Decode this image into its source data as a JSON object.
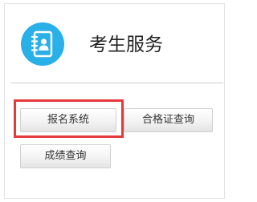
{
  "header": {
    "icon": "contact-book-icon",
    "title": "考生服务"
  },
  "buttons": {
    "registration_label": "报名系统",
    "certificate_query_label": "合格证查询",
    "score_query_label": "成绩查询"
  },
  "colors": {
    "accent": "#2ab0e8",
    "highlight": "#e5393b"
  }
}
